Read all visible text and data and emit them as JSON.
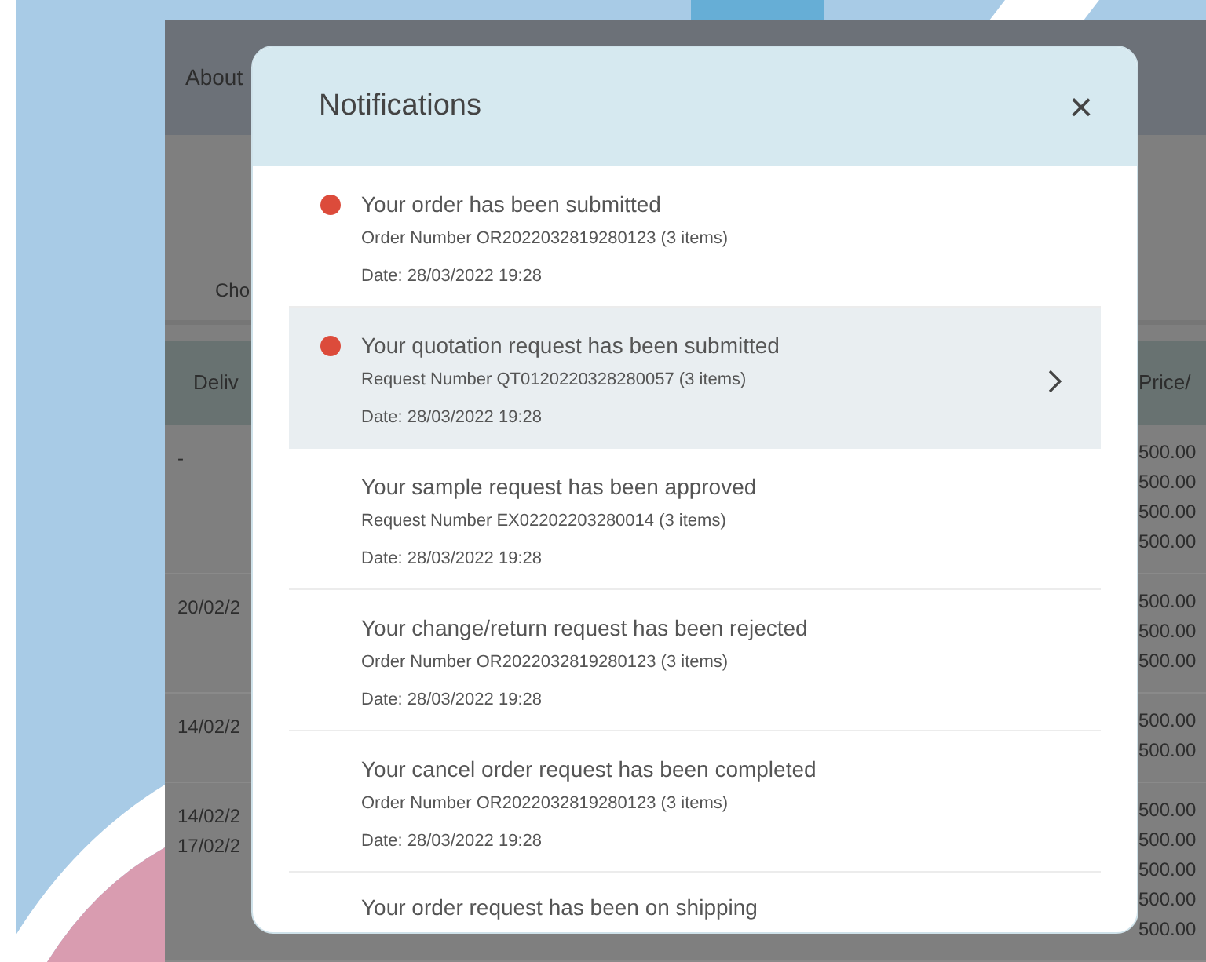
{
  "page": {
    "header": {
      "label": "About"
    },
    "filter": {
      "label": "Cho"
    },
    "table": {
      "columns": [
        "Deliv",
        "Price/"
      ],
      "rows": [
        {
          "dates": [
            "-"
          ],
          "prices": [
            "500.00",
            "500.00",
            "500.00",
            "500.00"
          ]
        },
        {
          "dates": [
            "20/02/2"
          ],
          "prices": [
            "500.00",
            "500.00",
            "500.00"
          ]
        },
        {
          "dates": [
            "14/02/2"
          ],
          "prices": [
            "500.00",
            "500.00"
          ]
        },
        {
          "dates": [
            "14/02/2",
            "17/02/2"
          ],
          "prices": [
            "500.00",
            "500.00",
            "500.00",
            "500.00",
            "500.00"
          ]
        }
      ]
    }
  },
  "modal": {
    "title": "Notifications",
    "close": "×",
    "notifications": [
      {
        "title": "Your order has been submitted",
        "reference": "Order Number OR2022032819280123 (3 items)",
        "date": "Date: 28/03/2022 19:28",
        "unread": true,
        "selected": false
      },
      {
        "title": "Your quotation request has been submitted",
        "reference": "Request Number QT0120220328280057 (3 items)",
        "date": "Date: 28/03/2022 19:28",
        "unread": true,
        "selected": true
      },
      {
        "title": "Your sample request has been approved",
        "reference": "Request Number EX02202203280014 (3 items)",
        "date": "Date: 28/03/2022 19:28",
        "unread": false,
        "selected": false
      },
      {
        "title": "Your change/return request has been rejected",
        "reference": "Order Number OR2022032819280123 (3 items)",
        "date": "Date: 28/03/2022 19:28",
        "unread": false,
        "selected": false
      },
      {
        "title": "Your cancel order request has been completed",
        "reference": "Order Number OR2022032819280123 (3 items)",
        "date": "Date: 28/03/2022 19:28",
        "unread": false,
        "selected": false
      },
      {
        "title": "Your order request has been on shipping",
        "unread": false,
        "selected": false
      }
    ]
  }
}
